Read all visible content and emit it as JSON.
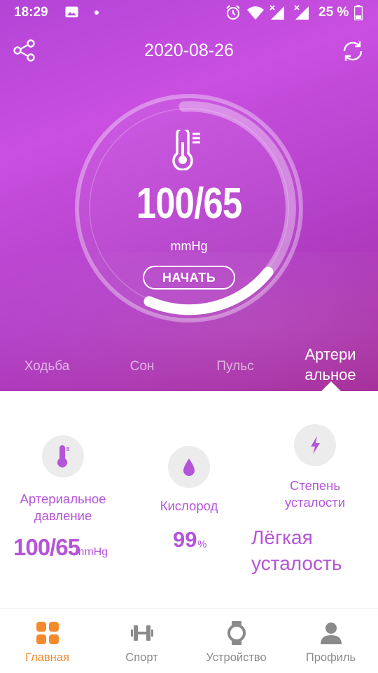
{
  "status_bar": {
    "time": "18:29",
    "battery": "25 %",
    "icons": [
      "image-icon",
      "dot-icon",
      "alarm-icon",
      "wifi-icon",
      "signal-icon",
      "signal-icon",
      "battery-icon"
    ]
  },
  "header": {
    "date": "2020-08-26",
    "share_icon": "share-icon",
    "sync_icon": "sync-icon"
  },
  "gauge": {
    "value": "100/65",
    "unit": "mmHg",
    "start_label": "НАЧАТЬ",
    "progress": 0.82,
    "icon": "thermometer-icon"
  },
  "tabs": [
    {
      "label": "Ходьба",
      "active": false
    },
    {
      "label": "Сон",
      "active": false
    },
    {
      "label": "Пульс",
      "active": false
    },
    {
      "label": "Артери альное",
      "active": true
    }
  ],
  "stats": [
    {
      "label": "Артериальное давление",
      "value": "100/65",
      "unit": "mmHg",
      "icon": "thermometer-icon"
    },
    {
      "label": "Кислород",
      "value": "99",
      "unit": "%",
      "icon": "drop-icon"
    },
    {
      "label": "Степень усталости",
      "value": "Лёгкая усталость",
      "icon": "lightning-icon"
    }
  ],
  "nav": [
    {
      "label": "Главная",
      "icon": "home-grid-icon",
      "active": true
    },
    {
      "label": "Спорт",
      "icon": "dumbbell-icon",
      "active": false
    },
    {
      "label": "Устройство",
      "icon": "watch-icon",
      "active": false
    },
    {
      "label": "Профиль",
      "icon": "profile-icon",
      "active": false
    }
  ],
  "colors": {
    "hero_gradient_start": "#c94fe0",
    "hero_gradient_end": "#a42a98",
    "accent_purple": "#b455d8",
    "nav_active": "#f48a2c",
    "nav_inactive": "#8a8a8a"
  }
}
